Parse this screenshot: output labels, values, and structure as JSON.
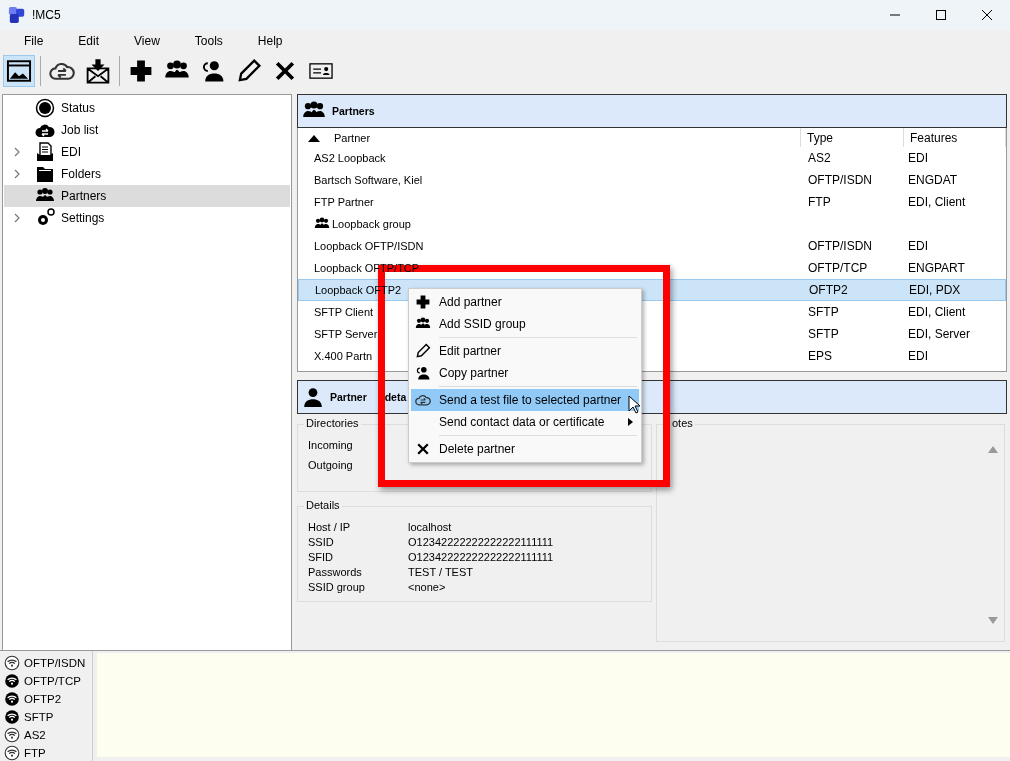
{
  "window": {
    "title": "!MC5"
  },
  "menu": [
    "File",
    "Edit",
    "View",
    "Tools",
    "Help"
  ],
  "toolbar": [
    {
      "selected": true
    },
    {
      "selected": false
    },
    {
      "selected": false
    },
    {
      "selected": false
    },
    {
      "selected": false
    },
    {
      "selected": false
    },
    {
      "selected": false
    },
    {
      "selected": false
    },
    {
      "selected": false
    }
  ],
  "sidebar": {
    "items": [
      {
        "label": "Status",
        "expandable": false,
        "selected": false
      },
      {
        "label": "Job list",
        "expandable": false,
        "selected": false
      },
      {
        "label": "EDI",
        "expandable": true,
        "selected": false
      },
      {
        "label": "Folders",
        "expandable": true,
        "selected": false
      },
      {
        "label": "Partners",
        "expandable": false,
        "selected": true
      },
      {
        "label": "Settings",
        "expandable": true,
        "selected": false
      }
    ]
  },
  "partners": {
    "title": "Partners",
    "columns": [
      "Partner",
      "Type",
      "Features"
    ],
    "rows": [
      {
        "name": "AS2 Loopback",
        "type": "AS2",
        "features": "EDI",
        "group": false,
        "selected": false
      },
      {
        "name": "Bartsch Software, Kiel",
        "type": "OFTP/ISDN",
        "features": "ENGDAT",
        "group": false,
        "selected": false
      },
      {
        "name": "FTP Partner",
        "type": "FTP",
        "features": "EDI, Client",
        "group": false,
        "selected": false
      },
      {
        "name": "Loopback group",
        "type": "",
        "features": "",
        "group": true,
        "selected": false
      },
      {
        "name": "Loopback OFTP/ISDN",
        "type": "OFTP/ISDN",
        "features": "EDI",
        "group": false,
        "selected": false
      },
      {
        "name": "Loopback OFTP/TCP",
        "type": "OFTP/TCP",
        "features": "ENGPART",
        "group": false,
        "selected": false
      },
      {
        "name": "Loopback OFTP2",
        "type": "OFTP2",
        "features": "EDI, PDX",
        "group": false,
        "selected": true
      },
      {
        "name": "SFTP Client",
        "type": "SFTP",
        "features": "EDI, Client",
        "group": false,
        "selected": false
      },
      {
        "name": "SFTP Server",
        "type": "SFTP",
        "features": "EDI, Server",
        "group": false,
        "selected": false
      },
      {
        "name": "X.400 Partn",
        "type": "EPS",
        "features": "EDI",
        "group": false,
        "selected": false
      }
    ]
  },
  "details": {
    "title": "Partner deta",
    "directories": {
      "title": "Directories",
      "labels": [
        "Incoming",
        "Outgoing"
      ]
    },
    "info": {
      "title": "Details",
      "rows": [
        {
          "label": "Host / IP",
          "value": "localhost"
        },
        {
          "label": "SSID",
          "value": "O12342222222222222111111"
        },
        {
          "label": "SFID",
          "value": "O12342222222222222111111"
        },
        {
          "label": "Passwords",
          "value": "TEST / TEST"
        },
        {
          "label": "SSID group",
          "value": "<none>"
        }
      ]
    },
    "notes": {
      "title": "otes"
    }
  },
  "connections": [
    {
      "label": "OFTP/ISDN",
      "on": false
    },
    {
      "label": "OFTP/TCP",
      "on": true
    },
    {
      "label": "OFTP2",
      "on": true
    },
    {
      "label": "SFTP",
      "on": true
    },
    {
      "label": "AS2",
      "on": false
    },
    {
      "label": "FTP",
      "on": false
    }
  ],
  "context_menu": [
    {
      "kind": "item",
      "label": "Add partner",
      "selected": false
    },
    {
      "kind": "item",
      "label": "Add SSID group",
      "selected": false
    },
    {
      "kind": "separator"
    },
    {
      "kind": "item",
      "label": "Edit partner",
      "selected": false
    },
    {
      "kind": "item",
      "label": "Copy partner",
      "selected": false
    },
    {
      "kind": "separator"
    },
    {
      "kind": "item",
      "label": "Send a test file to selected partner",
      "selected": true
    },
    {
      "kind": "submenu",
      "label": "Send contact data or certificate",
      "selected": false
    },
    {
      "kind": "separator"
    },
    {
      "kind": "item",
      "label": "Delete partner",
      "selected": false
    }
  ]
}
